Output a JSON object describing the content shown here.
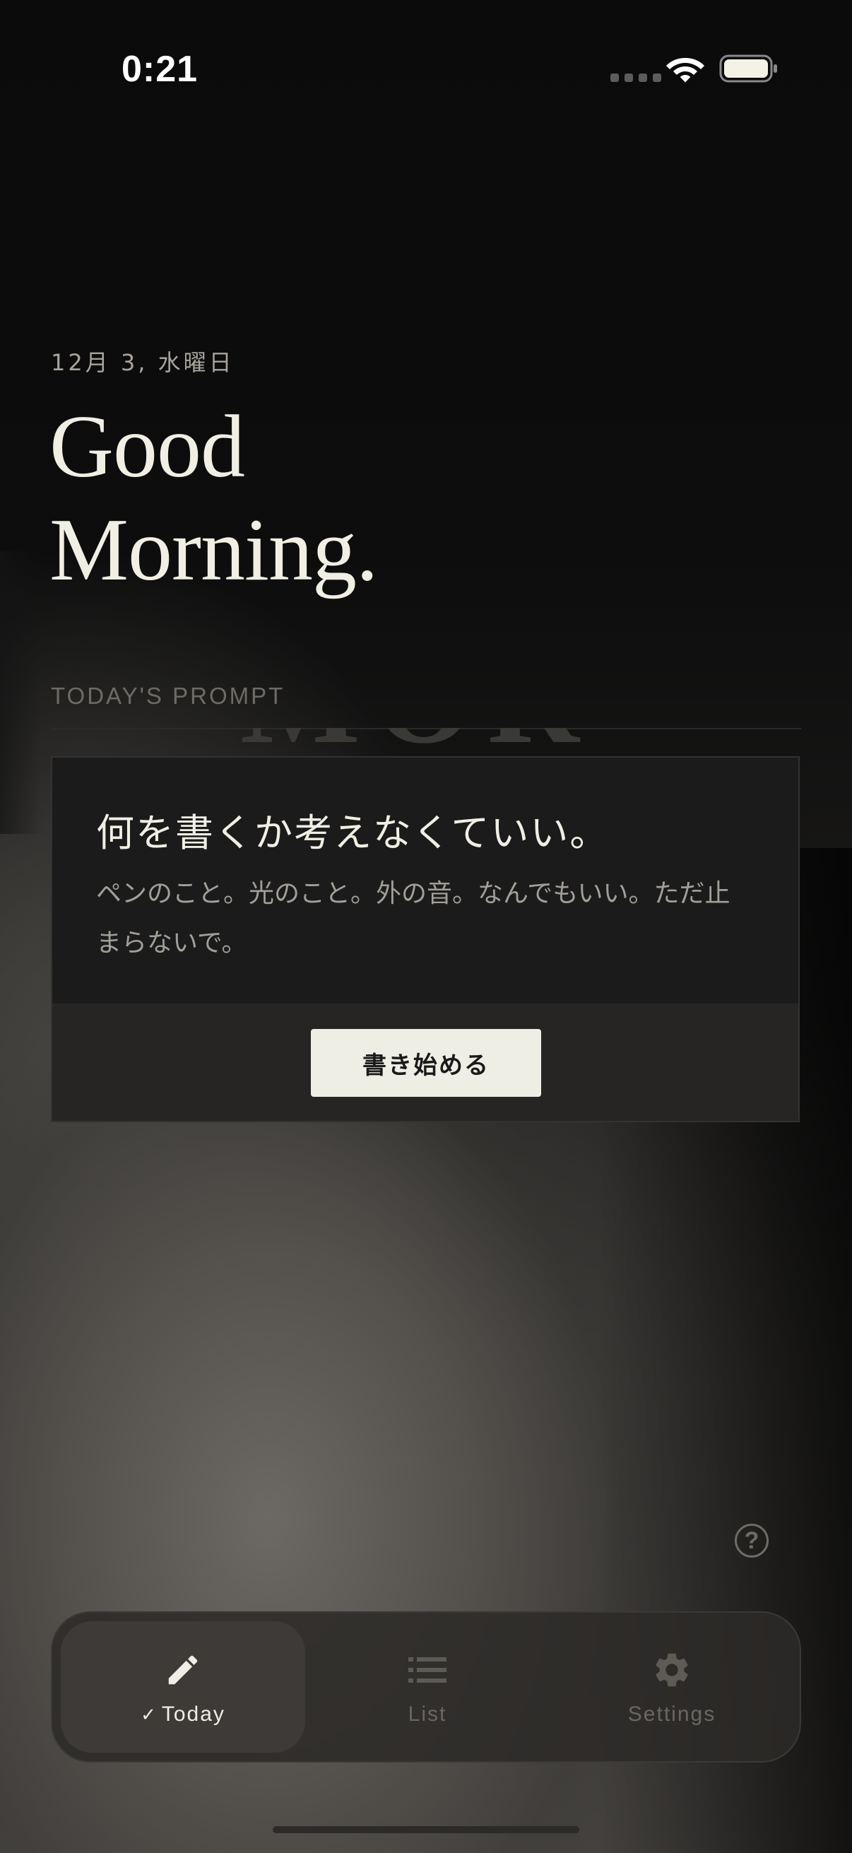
{
  "status_bar": {
    "time": "0:21"
  },
  "header": {
    "date": "12月 3, 水曜日",
    "greeting_line1": "Good",
    "greeting_line2": "Morning."
  },
  "prompt": {
    "section_label": "TODAY'S PROMPT",
    "background_text": "MOR",
    "title": "何を書くか考えなくていい。",
    "body": "ペンのこと。光のこと。外の音。なんでもいい。ただ止まらないで。",
    "start_button_label": "書き始める"
  },
  "help": {
    "icon_char": "?"
  },
  "tabbar": {
    "tabs": [
      {
        "label": "Today",
        "icon": "pencil-icon",
        "active": true
      },
      {
        "label": "List",
        "icon": "list-icon",
        "active": false
      },
      {
        "label": "Settings",
        "icon": "gear-icon",
        "active": false
      }
    ],
    "active_check": "✓"
  },
  "colors": {
    "accent": "#efeee4",
    "text_primary": "#f1efe4",
    "text_muted": "#a29f98",
    "card_bg": "#1b1b1b"
  }
}
